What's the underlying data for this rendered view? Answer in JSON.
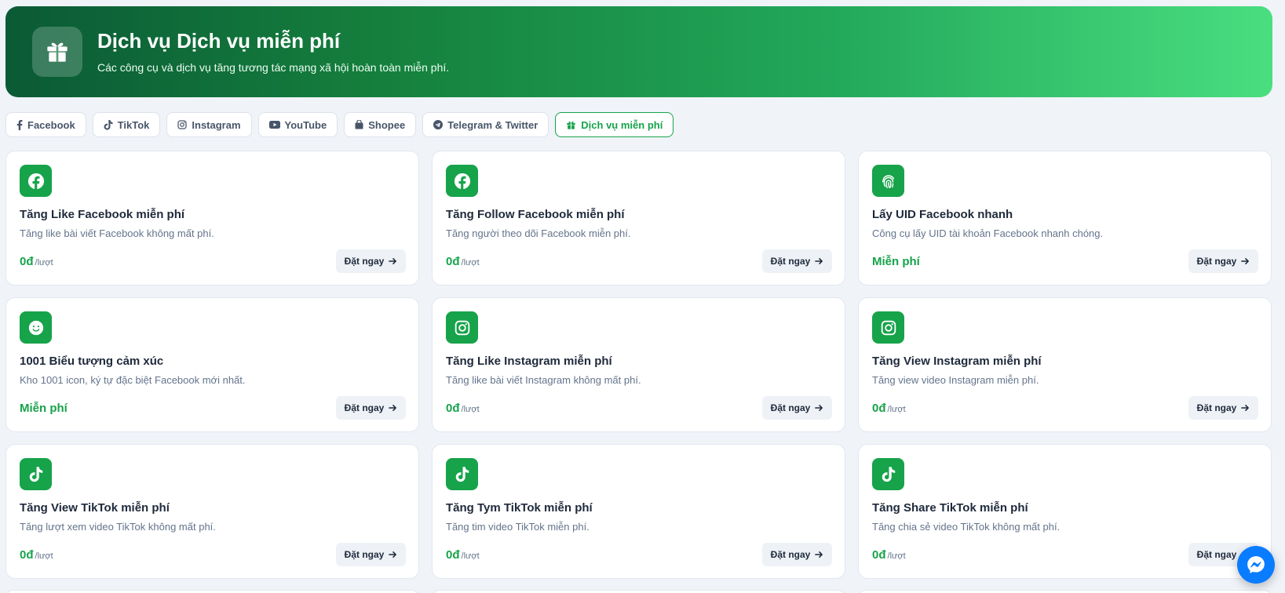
{
  "header": {
    "title": "Dịch vụ Dịch vụ miễn phí",
    "subtitle": "Các công cụ và dịch vụ tăng tương tác mạng xã hội hoàn toàn miễn phí.",
    "icon": "gift-icon"
  },
  "tabs": [
    {
      "label": "Facebook",
      "icon": "facebook-f-icon",
      "active": false
    },
    {
      "label": "TikTok",
      "icon": "tiktok-icon",
      "active": false
    },
    {
      "label": "Instagram",
      "icon": "instagram-icon",
      "active": false
    },
    {
      "label": "YouTube",
      "icon": "youtube-icon",
      "active": false
    },
    {
      "label": "Shopee",
      "icon": "shopping-bag-icon",
      "active": false
    },
    {
      "label": "Telegram & Twitter",
      "icon": "telegram-icon",
      "active": false
    },
    {
      "label": "Dịch vụ miễn phí",
      "icon": "gift-icon",
      "active": true
    }
  ],
  "cards": [
    {
      "title": "Tăng Like Facebook miễn phí",
      "desc": "Tăng like bài viết Facebook không mất phí.",
      "price": "0đ",
      "unit": "/lượt",
      "button": "Đặt ngay",
      "icon": "facebook-icon"
    },
    {
      "title": "Tăng Follow Facebook miễn phí",
      "desc": "Tăng người theo dõi Facebook miễn phí.",
      "price": "0đ",
      "unit": "/lượt",
      "button": "Đặt ngay",
      "icon": "facebook-icon"
    },
    {
      "title": "Lấy UID Facebook nhanh",
      "desc": "Công cụ lấy UID tài khoản Facebook nhanh chóng.",
      "price": "Miễn phí",
      "unit": "",
      "button": "Đặt ngay",
      "icon": "fingerprint-icon"
    },
    {
      "title": "1001 Biểu tượng cảm xúc",
      "desc": "Kho 1001 icon, ký tự đặc biệt Facebook mới nhất.",
      "price": "Miễn phí",
      "unit": "",
      "button": "Đặt ngay",
      "icon": "smile-icon"
    },
    {
      "title": "Tăng Like Instagram miễn phí",
      "desc": "Tăng like bài viết Instagram không mất phí.",
      "price": "0đ",
      "unit": "/lượt",
      "button": "Đặt ngay",
      "icon": "instagram-icon"
    },
    {
      "title": "Tăng View Instagram miễn phí",
      "desc": "Tăng view video Instagram miễn phí.",
      "price": "0đ",
      "unit": "/lượt",
      "button": "Đặt ngay",
      "icon": "instagram-icon"
    },
    {
      "title": "Tăng View TikTok miễn phí",
      "desc": "Tăng lượt xem video TikTok không mất phí.",
      "price": "0đ",
      "unit": "/lượt",
      "button": "Đặt ngay",
      "icon": "tiktok-icon"
    },
    {
      "title": "Tăng Tym TikTok miễn phí",
      "desc": "Tăng tim video TikTok miễn phí.",
      "price": "0đ",
      "unit": "/lượt",
      "button": "Đặt ngay",
      "icon": "tiktok-icon"
    },
    {
      "title": "Tăng Share TikTok miễn phí",
      "desc": "Tăng chia sẻ video TikTok không mất phí.",
      "price": "0đ",
      "unit": "/lượt",
      "button": "Đặt ngay",
      "icon": "tiktok-icon"
    }
  ],
  "colors": {
    "accent": "#16a34a",
    "banner_dark": "#0b5a36",
    "banner_light": "#4ade80",
    "messenger": "#0a7cff"
  },
  "floating": {
    "icon": "messenger-icon"
  }
}
